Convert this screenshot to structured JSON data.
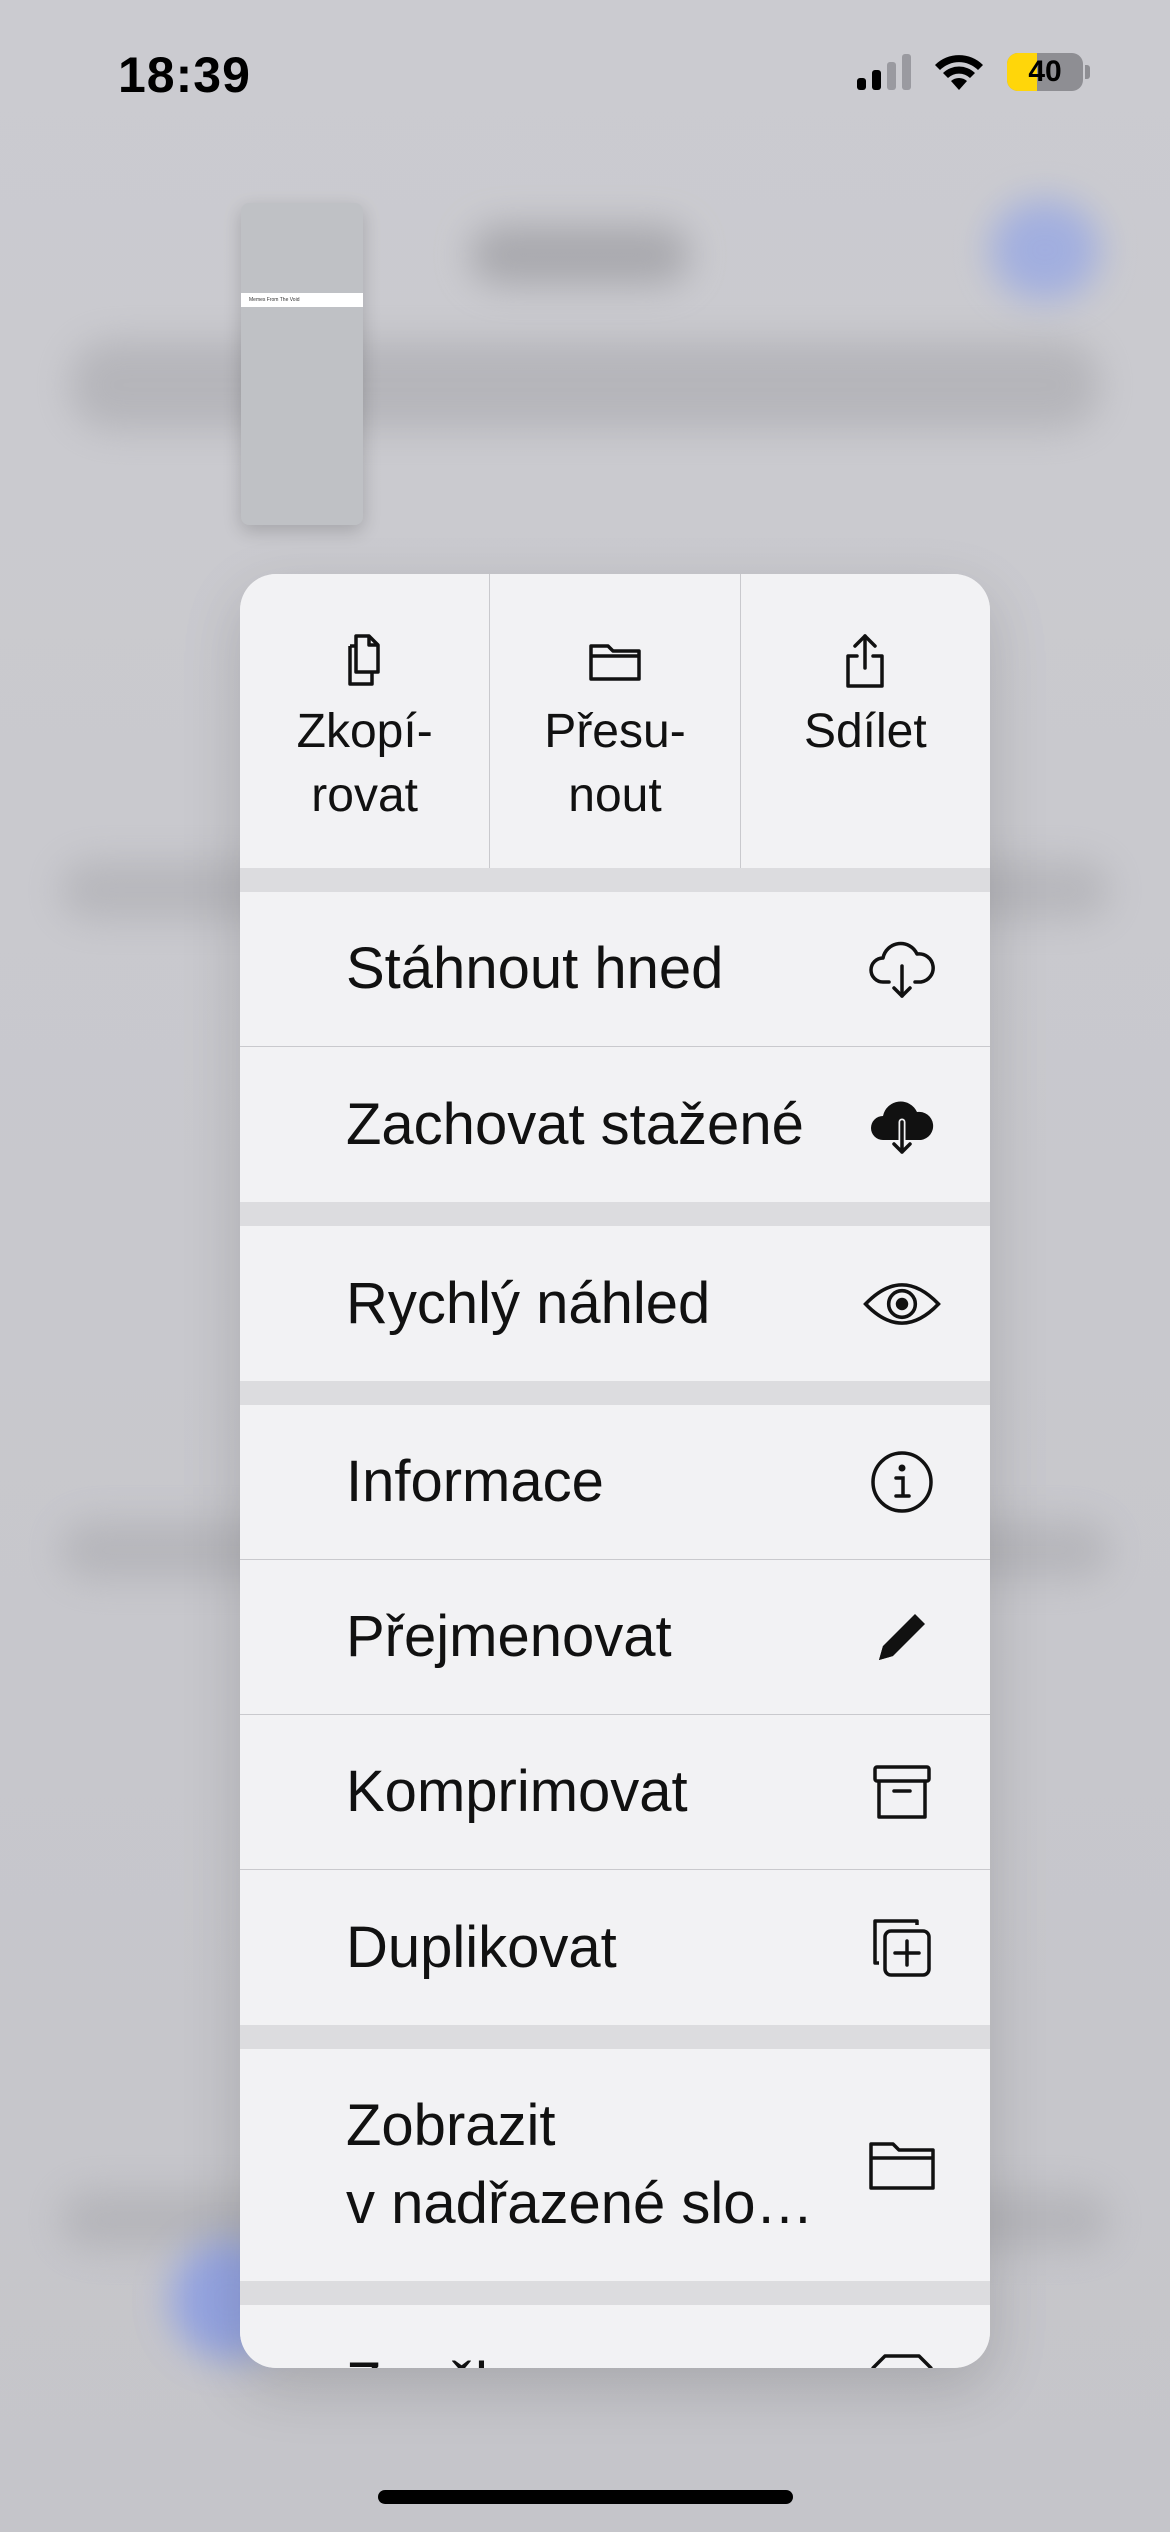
{
  "status_bar": {
    "time": "18:39",
    "battery": "40"
  },
  "thumbnail": {
    "caption": "Memes From The Void"
  },
  "menu": {
    "top_actions": [
      {
        "label": "Zkopí-\nrovat",
        "icon": "copy-icon"
      },
      {
        "label": "Přesu-\nnout",
        "icon": "folder-icon"
      },
      {
        "label": "Sdílet",
        "icon": "share-icon"
      }
    ],
    "download_now": {
      "label": "Stáhnout hned",
      "icon": "cloud-download-outline-icon"
    },
    "keep_downloaded": {
      "label": "Zachovat stažené",
      "icon": "cloud-download-filled-icon"
    },
    "quick_look": {
      "label": "Rychlý náhled",
      "icon": "eye-icon"
    },
    "info": {
      "label": "Informace",
      "icon": "info-icon"
    },
    "rename": {
      "label": "Přejmenovat",
      "icon": "pencil-icon"
    },
    "compress": {
      "label": "Komprimovat",
      "icon": "archive-box-icon"
    },
    "duplicate": {
      "label": "Duplikovat",
      "icon": "duplicate-icon"
    },
    "show_in_folder": {
      "label": "Zobrazit\nv nadřazené slo…",
      "icon": "folder-icon"
    },
    "partial_item": {
      "label": "Značky",
      "icon": "tag-icon"
    }
  }
}
